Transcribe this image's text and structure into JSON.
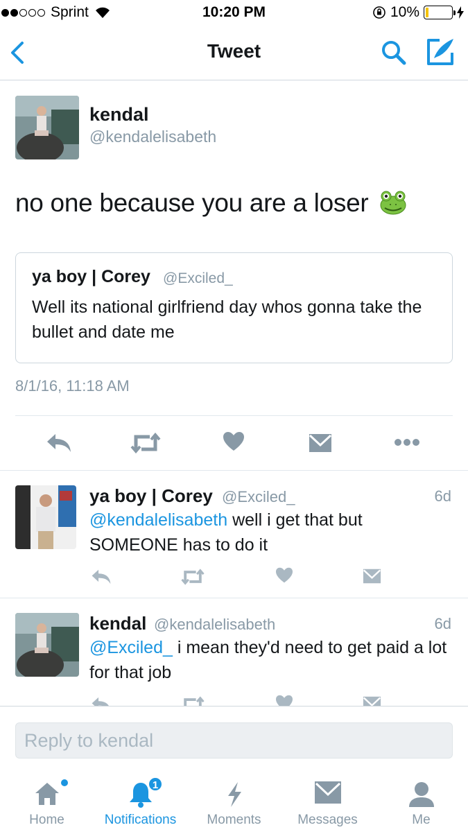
{
  "status_bar": {
    "carrier": "Sprint",
    "time": "10:20 PM",
    "battery": "10%",
    "signal_bars_filled": 2,
    "signal_bars_total": 5,
    "battery_level": 0.1
  },
  "nav": {
    "title": "Tweet"
  },
  "main_tweet": {
    "name": "kendal",
    "handle": "@kendalelisabeth",
    "text": "no one because you are a loser",
    "emoji": "frog-face-emoji",
    "timestamp": "8/1/16, 11:18 AM",
    "quote": {
      "name": "ya boy | Corey",
      "handle": "@Exciled_",
      "text": "Well its national girlfriend day whos gonna take the bullet and date me"
    }
  },
  "replies": [
    {
      "name": "ya boy | Corey",
      "handle": "@Exciled_",
      "time": "6d",
      "mention": "@kendalelisabeth",
      "text": " well i get that but SOMEONE has to do it"
    },
    {
      "name": "kendal",
      "handle": "@kendalelisabeth",
      "time": "6d",
      "mention": "@Exciled_",
      "text": " i mean they'd need to get paid a lot for that job"
    }
  ],
  "reply_box": {
    "placeholder": "Reply to kendal"
  },
  "tabs": [
    {
      "label": "Home",
      "icon": "home-icon"
    },
    {
      "label": "Notifications",
      "icon": "bell-icon",
      "badge": "1",
      "active": true
    },
    {
      "label": "Moments",
      "icon": "lightning-icon"
    },
    {
      "label": "Messages",
      "icon": "envelope-icon"
    },
    {
      "label": "Me",
      "icon": "person-icon"
    }
  ],
  "colors": {
    "accent": "#1b95e0",
    "muted": "#8899a6",
    "icon_gray": "#8899a6",
    "text": "#14171a"
  }
}
